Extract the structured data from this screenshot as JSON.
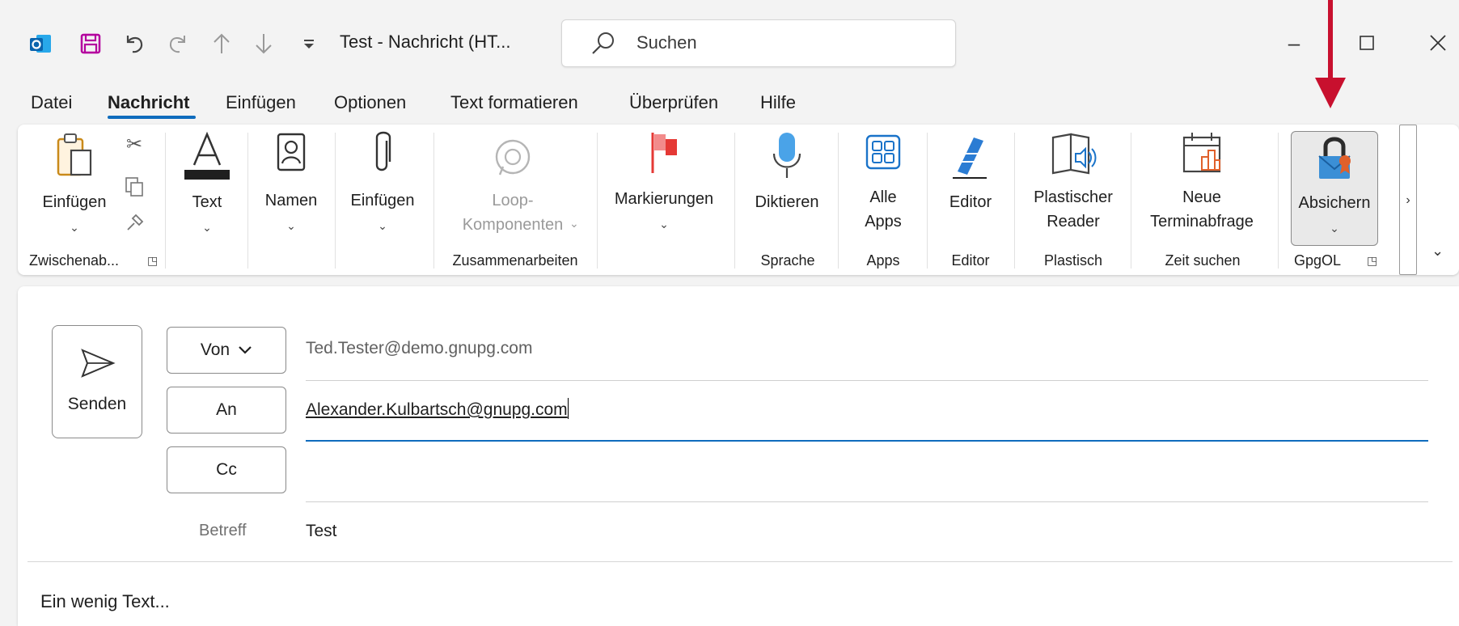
{
  "titlebar": {
    "title": "Test - Nachricht (HT...",
    "search_placeholder": "Suchen",
    "icons": [
      "outlook-icon",
      "save-icon",
      "undo-icon",
      "redo-icon",
      "up-arrow-icon",
      "down-arrow-icon",
      "customize-qat-icon"
    ],
    "window_buttons": {
      "minimize": "–",
      "maximize": "☐",
      "close": "✕"
    }
  },
  "tabs": [
    {
      "label": "Datei"
    },
    {
      "label": "Nachricht"
    },
    {
      "label": "Einfügen"
    },
    {
      "label": "Optionen"
    },
    {
      "label": "Text formatieren"
    },
    {
      "label": "Überprüfen"
    },
    {
      "label": "Hilfe"
    }
  ],
  "ribbon": {
    "paste": {
      "label": "Einfügen"
    },
    "text": {
      "label": "Text"
    },
    "names": {
      "label": "Namen"
    },
    "attach": {
      "label": "Einfügen"
    },
    "loop": {
      "line1": "Loop-",
      "line2": "Komponenten"
    },
    "flags": {
      "label": "Markierungen"
    },
    "dictate": {
      "label": "Diktieren"
    },
    "apps": {
      "line1": "Alle",
      "line2": "Apps"
    },
    "editor": {
      "label": "Editor"
    },
    "reader": {
      "line1": "Plastischer",
      "line2": "Reader"
    },
    "poll": {
      "line1": "Neue",
      "line2": "Terminabfrage"
    },
    "secure": {
      "label": "Absichern"
    },
    "groups": {
      "clipboard": "Zwischenab...",
      "collab": "Zusammenarbeiten",
      "speech": "Sprache",
      "apps": "Apps",
      "editor": "Editor",
      "immersive": "Plastisch",
      "findtime": "Zeit suchen",
      "gpgol": "GpgOL"
    }
  },
  "compose": {
    "send_label": "Senden",
    "from_label": "Von",
    "from_value": "Ted.Tester@demo.gnupg.com",
    "to_label": "An",
    "to_value": "Alexander.Kulbartsch@gnupg.com",
    "cc_label": "Cc",
    "cc_value": "",
    "subject_label": "Betreff",
    "subject_value": "Test",
    "body": "Ein wenig Text..."
  },
  "colors": {
    "accent": "#0f6cbd",
    "arrow": "#c8102e",
    "flag": "#e53935"
  }
}
